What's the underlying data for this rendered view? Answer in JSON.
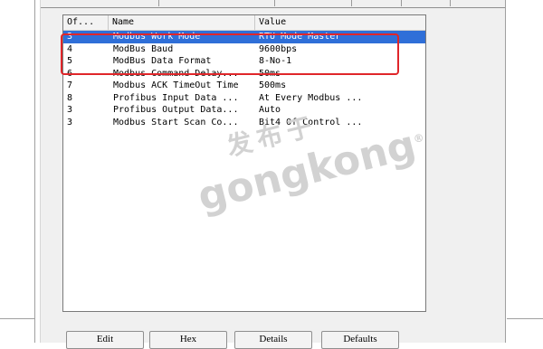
{
  "list": {
    "columns": [
      "Of...",
      "Name",
      "Value"
    ],
    "rows": [
      {
        "offset": "3",
        "name": "Modbus Work Mode",
        "value": "RTU Mode Master"
      },
      {
        "offset": "4",
        "name": "ModBus Baud",
        "value": "9600bps"
      },
      {
        "offset": "5",
        "name": "ModBus Data Format",
        "value": "8-No-1"
      },
      {
        "offset": "6",
        "name": "Modbus Command Delay...",
        "value": "50ms"
      },
      {
        "offset": "7",
        "name": "Modbus ACK TimeOut Time",
        "value": "500ms"
      },
      {
        "offset": "8",
        "name": "Profibus Input Data ...",
        "value": "At Every Modbus ..."
      },
      {
        "offset": "3",
        "name": "Profibus Output Data...",
        "value": "Auto"
      },
      {
        "offset": "3",
        "name": "Modbus Start Scan Co...",
        "value": "Bit4 Of Control ..."
      }
    ],
    "selected_row": 0
  },
  "buttons": {
    "edit": "Edit",
    "hex": "Hex",
    "details": "Details",
    "defaults": "Defaults"
  },
  "watermark": {
    "line1": "发布于",
    "line2": "gongkong",
    "mark": "®"
  },
  "colors": {
    "selection": "#2f6fd8",
    "highlight_box": "#e0262a",
    "dialog_bg": "#f0f0f0"
  }
}
